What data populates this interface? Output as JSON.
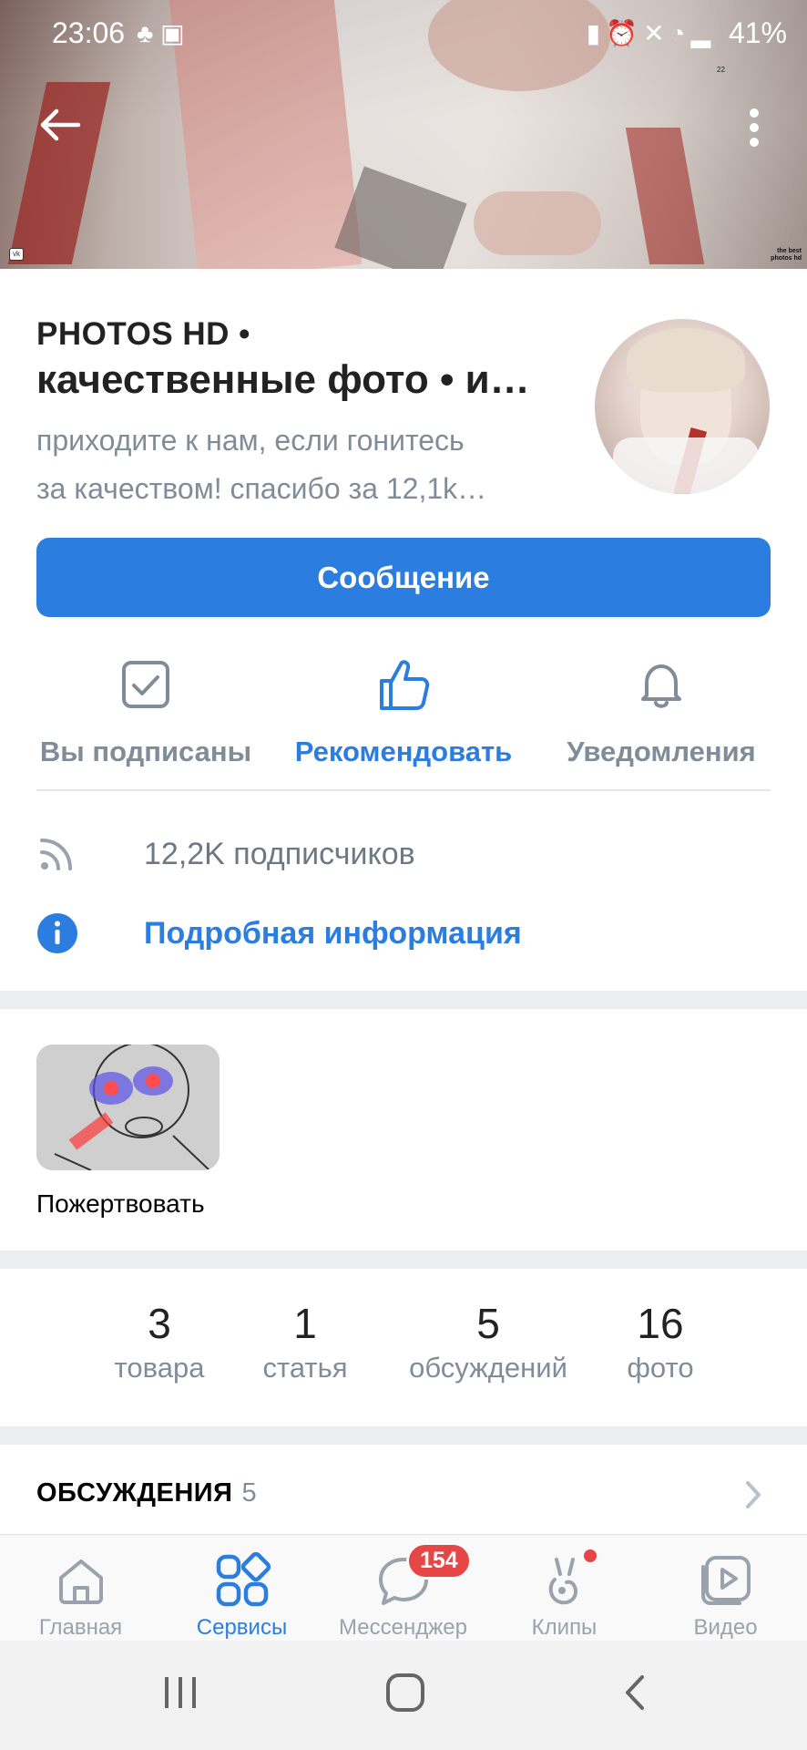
{
  "status_bar": {
    "time": "23:06",
    "left_icons": [
      "app-notification-icon",
      "image-icon"
    ],
    "right_icons": [
      "battery-saver-icon",
      "alarm-icon",
      "mute-icon",
      "wifi-icon",
      "signal-icon"
    ],
    "battery": "41%"
  },
  "cover": {
    "corner_text": "the best photos hd",
    "small_number": "22"
  },
  "group": {
    "title_line1": "PHOTOS HD •",
    "title_line2": "качественные фото • и…",
    "status_line1": "приходите к нам, если гонитесь",
    "status_line2": "за качеством! спасибо за 12,1k…"
  },
  "buttons": {
    "message": "Сообщение"
  },
  "actions": [
    {
      "label": "Вы подписаны",
      "icon": "checkbox-icon"
    },
    {
      "label": "Рекомендовать",
      "icon": "thumbs-up-icon"
    },
    {
      "label": "Уведомления",
      "icon": "bell-icon"
    }
  ],
  "info": {
    "subscribers": "12,2K подписчиков",
    "details": "Подробная информация"
  },
  "donate": {
    "label": "Пожертвовать"
  },
  "counters": [
    {
      "value": "3",
      "label": "товара"
    },
    {
      "value": "1",
      "label": "статья"
    },
    {
      "value": "5",
      "label": "обсуждений"
    },
    {
      "value": "16",
      "label": "фото"
    }
  ],
  "discussions": {
    "title": "ОБСУЖДЕНИЯ",
    "count": "5"
  },
  "tabbar": {
    "tabs": [
      {
        "label": "Главная",
        "icon": "home-icon"
      },
      {
        "label": "Сервисы",
        "icon": "services-icon"
      },
      {
        "label": "Мессенджер",
        "icon": "messenger-icon",
        "badge": "154"
      },
      {
        "label": "Клипы",
        "icon": "clips-icon"
      },
      {
        "label": "Видео",
        "icon": "video-icon"
      }
    ]
  },
  "colors": {
    "accent": "#2c7de0",
    "secondary_text": "#818c99",
    "badge": "#e64646"
  }
}
